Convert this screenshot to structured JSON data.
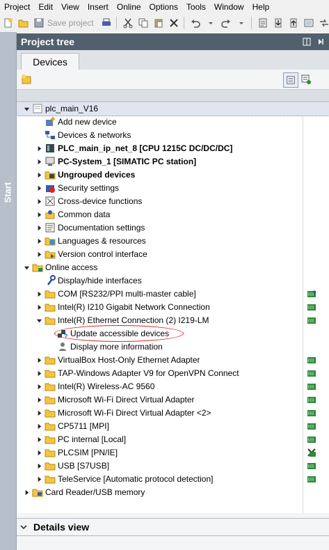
{
  "menu": [
    "Project",
    "Edit",
    "View",
    "Insert",
    "Online",
    "Options",
    "Tools",
    "Window",
    "Help"
  ],
  "toolbar": {
    "save_label": "Save project"
  },
  "start_tab": {
    "label": "Start"
  },
  "panel": {
    "title": "Project tree",
    "tab": "Devices"
  },
  "tree": [
    {
      "label": "plc_main_V16",
      "level": 0,
      "exp": "open",
      "icon": "project-icon",
      "bold": false,
      "status": null,
      "selected": true
    },
    {
      "label": "Add new device",
      "level": 1,
      "exp": null,
      "icon": "add-device-icon",
      "bold": false,
      "status": null
    },
    {
      "label": "Devices & networks",
      "level": 1,
      "exp": null,
      "icon": "network-icon",
      "bold": false,
      "status": null
    },
    {
      "label": "PLC_main_ip_net_8 [CPU 1215C DC/DC/DC]",
      "level": 1,
      "exp": "closed",
      "icon": "plc-icon",
      "bold": true,
      "status": null
    },
    {
      "label": "PC-System_1 [SIMATIC PC station]",
      "level": 1,
      "exp": "closed",
      "icon": "pc-station-icon",
      "bold": true,
      "status": null
    },
    {
      "label": "Ungrouped devices",
      "level": 1,
      "exp": "closed",
      "icon": "ungrouped-devices-icon",
      "bold": true,
      "status": null
    },
    {
      "label": "Security settings",
      "level": 1,
      "exp": "closed",
      "icon": "security-icon",
      "bold": false,
      "status": null
    },
    {
      "label": "Cross-device functions",
      "level": 1,
      "exp": "closed",
      "icon": "cross-device-icon",
      "bold": false,
      "status": null
    },
    {
      "label": "Common data",
      "level": 1,
      "exp": "closed",
      "icon": "common-data-icon",
      "bold": false,
      "status": null
    },
    {
      "label": "Documentation settings",
      "level": 1,
      "exp": "closed",
      "icon": "documentation-icon",
      "bold": false,
      "status": null
    },
    {
      "label": "Languages & resources",
      "level": 1,
      "exp": "closed",
      "icon": "languages-icon",
      "bold": false,
      "status": null
    },
    {
      "label": "Version control interface",
      "level": 1,
      "exp": "closed",
      "icon": "version-control-icon",
      "bold": false,
      "status": null
    },
    {
      "label": "Online access",
      "level": 0,
      "exp": "open",
      "icon": "online-access-icon",
      "bold": false,
      "status": null
    },
    {
      "label": "Display/hide interfaces",
      "level": 1,
      "exp": null,
      "icon": "wrench-icon",
      "bold": false,
      "status": null
    },
    {
      "label": "COM [RS232/PPI multi-master cable]",
      "level": 1,
      "exp": "closed",
      "icon": "folder-icon",
      "bold": false,
      "status": "unknown"
    },
    {
      "label": "Intel(R) I210 Gigabit Network Connection",
      "level": 1,
      "exp": "closed",
      "icon": "folder-icon",
      "bold": false,
      "status": "ok"
    },
    {
      "label": "Intel(R) Ethernet Connection (2) I219-LM",
      "level": 1,
      "exp": "open",
      "icon": "folder-icon",
      "bold": false,
      "status": "ok"
    },
    {
      "label": "Update accessible devices",
      "level": 2,
      "exp": null,
      "icon": "update-devices-icon",
      "bold": false,
      "status": null,
      "circled": true
    },
    {
      "label": "Display more information",
      "level": 2,
      "exp": null,
      "icon": "more-info-icon",
      "bold": false,
      "status": null
    },
    {
      "label": "VirtualBox Host-Only Ethernet Adapter",
      "level": 1,
      "exp": "closed",
      "icon": "folder-icon",
      "bold": false,
      "status": "ok"
    },
    {
      "label": "TAP-Windows Adapter V9 for OpenVPN Connect",
      "level": 1,
      "exp": "closed",
      "icon": "folder-icon",
      "bold": false,
      "status": "ok"
    },
    {
      "label": "Intel(R) Wireless-AC 9560",
      "level": 1,
      "exp": "closed",
      "icon": "folder-icon",
      "bold": false,
      "status": "ok"
    },
    {
      "label": "Microsoft Wi-Fi Direct Virtual Adapter",
      "level": 1,
      "exp": "closed",
      "icon": "folder-icon",
      "bold": false,
      "status": "ok"
    },
    {
      "label": "Microsoft Wi-Fi Direct Virtual Adapter <2>",
      "level": 1,
      "exp": "closed",
      "icon": "folder-icon",
      "bold": false,
      "status": "ok"
    },
    {
      "label": "CP5711 [MPI]",
      "level": 1,
      "exp": "closed",
      "icon": "folder-icon",
      "bold": false,
      "status": "ok"
    },
    {
      "label": "PC internal [Local]",
      "level": 1,
      "exp": "closed",
      "icon": "folder-icon",
      "bold": false,
      "status": "ok"
    },
    {
      "label": "PLCSIM [PN/IE]",
      "level": 1,
      "exp": "closed",
      "icon": "folder-icon",
      "bold": false,
      "status": "error"
    },
    {
      "label": "USB [S7USB]",
      "level": 1,
      "exp": "closed",
      "icon": "folder-icon",
      "bold": false,
      "status": "ok"
    },
    {
      "label": "TeleService [Automatic protocol detection]",
      "level": 1,
      "exp": "closed",
      "icon": "folder-icon",
      "bold": false,
      "status": "ok"
    },
    {
      "label": "Card Reader/USB memory",
      "level": 0,
      "exp": "closed",
      "icon": "card-reader-icon",
      "bold": false,
      "status": null
    }
  ],
  "details": {
    "title": "Details view"
  },
  "colors": {
    "title_bar": "#52606d",
    "start_tab": "#b6bfca",
    "folder": "#f5c542",
    "status_ok": "#2e8b3a",
    "circle": "#dd2222"
  }
}
